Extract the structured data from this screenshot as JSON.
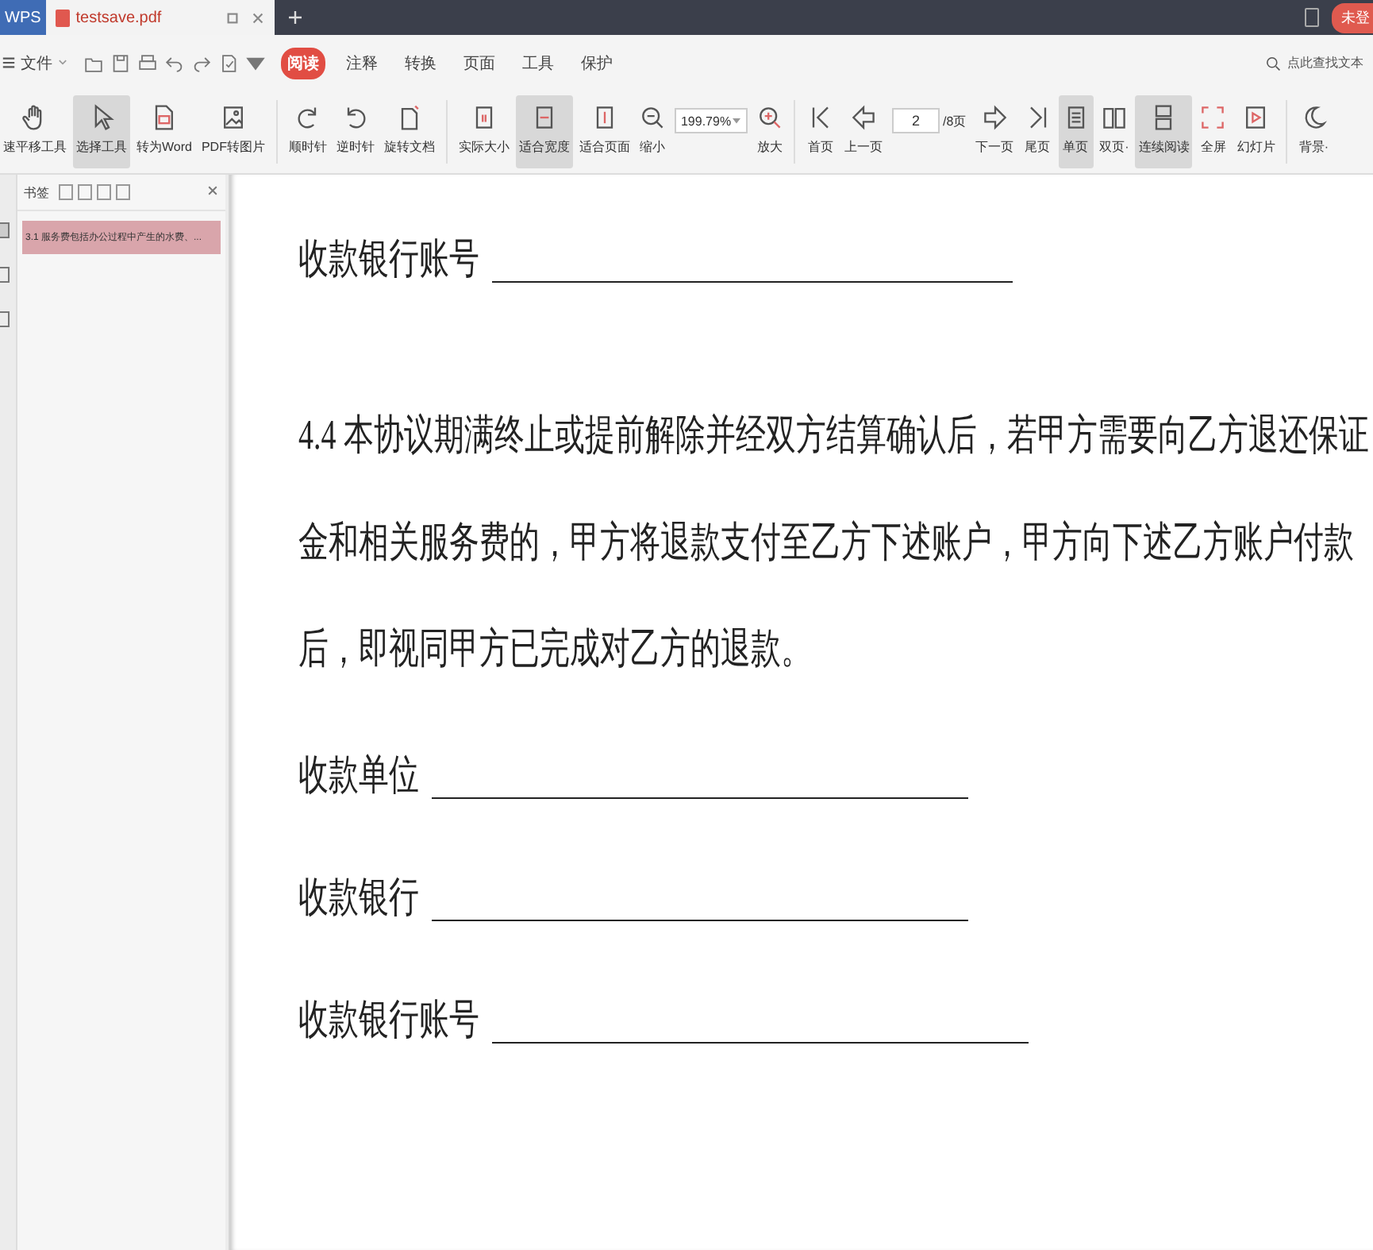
{
  "tabs": [
    {
      "label": "WPS",
      "kind": "home",
      "selected": false
    },
    {
      "label": "testsave.pdf",
      "kind": "file",
      "selected": true
    }
  ],
  "account_button": "未登",
  "menu": {
    "file_label": "文件",
    "tabs": [
      {
        "label": "阅读",
        "selected": true
      },
      {
        "label": "注释",
        "selected": false
      },
      {
        "label": "转换",
        "selected": false
      },
      {
        "label": "页面",
        "selected": false
      },
      {
        "label": "工具",
        "selected": false
      },
      {
        "label": "保护",
        "selected": false
      }
    ],
    "search": {
      "placeholder": "点此查找文本"
    }
  },
  "toolbar": [
    {
      "kind": "tool",
      "label": "速平移工具",
      "selected": false
    },
    {
      "kind": "tool",
      "label": "选择工具",
      "selected": true
    },
    {
      "kind": "tool",
      "label": "转为Word",
      "selected": false
    },
    {
      "kind": "tool",
      "label": "PDF转图片",
      "selected": false
    },
    {
      "kind": "sep"
    },
    {
      "kind": "tool",
      "label": "顺时针",
      "selected": false
    },
    {
      "kind": "tool",
      "label": "逆时针",
      "selected": false
    },
    {
      "kind": "tool",
      "label": "旋转文档",
      "selected": false
    },
    {
      "kind": "sep"
    },
    {
      "kind": "tool",
      "label": "实际大小",
      "selected": false
    },
    {
      "kind": "tool",
      "label": "适合宽度",
      "selected": true
    },
    {
      "kind": "tool",
      "label": "适合页面",
      "selected": false
    },
    {
      "kind": "zoom",
      "out_label": "缩小",
      "value": "199.79%",
      "in_label": "放大"
    },
    {
      "kind": "sep"
    },
    {
      "kind": "tool",
      "label": "首页",
      "selected": false
    },
    {
      "kind": "tool",
      "label": "上一页",
      "selected": false
    },
    {
      "kind": "page",
      "value": "2",
      "total": "/8页"
    },
    {
      "kind": "tool",
      "label": "下一页",
      "selected": false
    },
    {
      "kind": "tool",
      "label": "尾页",
      "selected": false
    },
    {
      "kind": "tool",
      "label": "单页",
      "selected": true
    },
    {
      "kind": "tool",
      "label": "双页·",
      "selected": false
    },
    {
      "kind": "tool",
      "label": "连续阅读",
      "selected": true
    },
    {
      "kind": "tool",
      "label": "全屏",
      "selected": false
    },
    {
      "kind": "tool",
      "label": "幻灯片",
      "selected": false
    },
    {
      "kind": "sep"
    },
    {
      "kind": "tool",
      "label": "背景·",
      "selected": false
    }
  ],
  "sidebar": {
    "title": "书签",
    "items": [
      {
        "label": "3.1 服务费包括办公过程中产生的水费、...",
        "selected": true
      }
    ]
  },
  "document": [
    {
      "kind": "blank",
      "label": "收款银行账号"
    },
    {
      "kind": "paragraph",
      "lines": [
        "4.4 本协议期满终止或提前解除并经双方结算确认后，若甲方需要向乙方退还保证",
        "金和相关服务费的，甲方将退款支付至乙方下述账户，甲方向下述乙方账户付款",
        "后，即视同甲方已完成对乙方的退款。"
      ]
    },
    {
      "kind": "blank",
      "label": "收款单位"
    },
    {
      "kind": "blank",
      "label": "收款银行"
    },
    {
      "kind": "blank",
      "label": "收款银行账号"
    }
  ]
}
